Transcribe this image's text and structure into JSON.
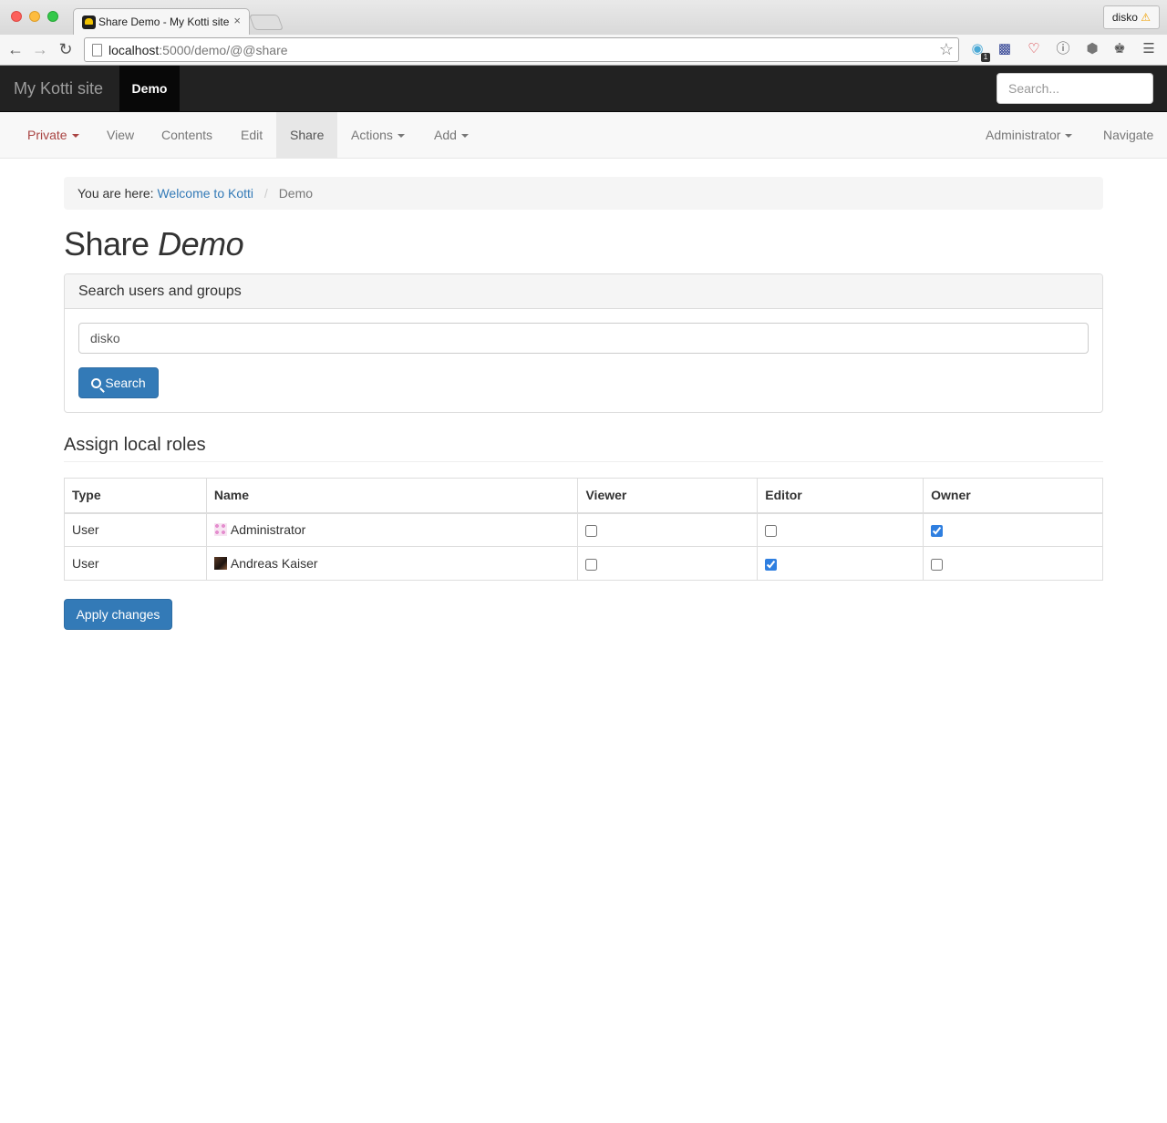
{
  "browser": {
    "tab_title": "Share Demo - My Kotti site",
    "tab_close": "×",
    "profile_name": "disko",
    "profile_warning": "⚠",
    "url_host": "localhost",
    "url_path": ":5000/demo/@@share",
    "icons": [
      "back-icon",
      "forward-icon",
      "reload-icon",
      "page-icon",
      "star-icon",
      "ghostery-icon",
      "hb-icon",
      "heart-icon",
      "info-icon",
      "angular-icon",
      "stamp-icon",
      "menu-icon"
    ],
    "extension_badge": "1"
  },
  "navbar": {
    "brand": "My Kotti site",
    "current": "Demo",
    "search_placeholder": "Search..."
  },
  "editbar": {
    "state": "Private",
    "view": "View",
    "contents": "Contents",
    "edit": "Edit",
    "share": "Share",
    "actions": "Actions",
    "add": "Add",
    "user": "Administrator",
    "navigate": "Navigate"
  },
  "breadcrumb": {
    "prefix": "You are here:",
    "home": "Welcome to Kotti",
    "separator": "/",
    "current": "Demo"
  },
  "page": {
    "title_prefix": "Share",
    "title_context": "Demo"
  },
  "search_panel": {
    "heading": "Search users and groups",
    "query": "disko",
    "button": "Search"
  },
  "roles": {
    "heading": "Assign local roles",
    "columns": [
      "Type",
      "Name",
      "Viewer",
      "Editor",
      "Owner"
    ],
    "rows": [
      {
        "type": "User",
        "name": "Administrator",
        "viewer": false,
        "editor": false,
        "owner": true
      },
      {
        "type": "User",
        "name": "Andreas Kaiser",
        "viewer": false,
        "editor": true,
        "owner": false
      }
    ],
    "apply_button": "Apply changes"
  },
  "colors": {
    "primary": "#337ab7",
    "navbar_bg": "#222222",
    "private_state": "#a94442"
  }
}
